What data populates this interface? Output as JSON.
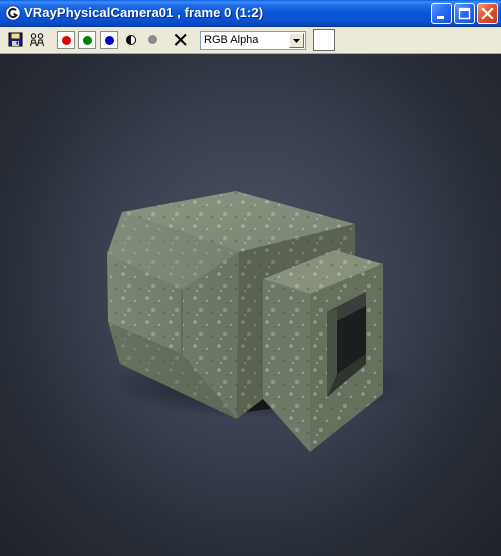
{
  "window": {
    "title": "VRayPhysicalCamera01 , frame 0 (1:2)",
    "title_bar_color": "#0a52d0",
    "close_button_color": "#e0512f"
  },
  "toolbar": {
    "tools": [
      {
        "name": "save-image-icon"
      },
      {
        "name": "clone-window-icon"
      },
      {
        "name": "red-channel-icon",
        "color": "#e00000"
      },
      {
        "name": "green-channel-icon",
        "color": "#008000"
      },
      {
        "name": "blue-channel-icon",
        "color": "#0000d0"
      },
      {
        "name": "monochrome-icon"
      },
      {
        "name": "alpha-channel-icon",
        "color": "#8a8a8a"
      },
      {
        "name": "clear-icon"
      }
    ],
    "channel_select": {
      "value": "RGB Alpha"
    },
    "color_swatch": "#ffffff"
  },
  "viewport": {
    "background_color": "#394150",
    "render_subject": "concrete-bunker-render"
  }
}
